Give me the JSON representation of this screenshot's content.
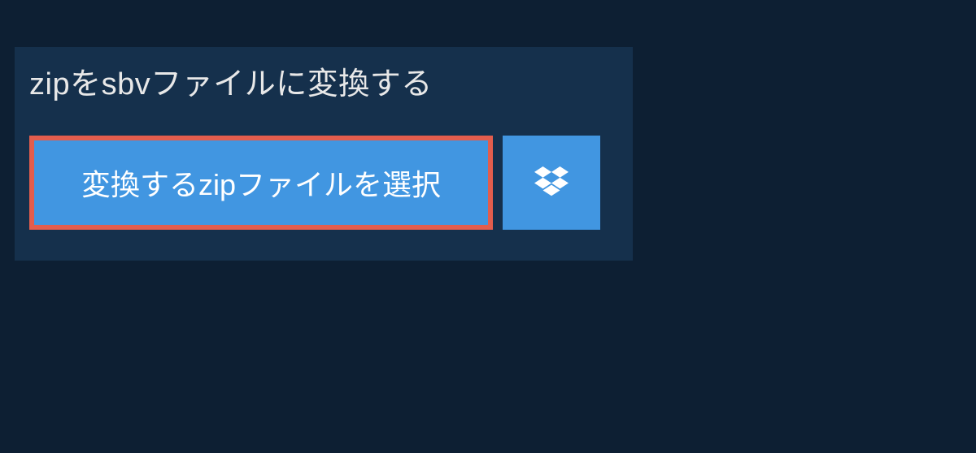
{
  "header": {
    "title": "zipをsbvファイルに変換する"
  },
  "actions": {
    "select_file_label": "変換するzipファイルを選択"
  },
  "colors": {
    "background": "#0d1f33",
    "panel": "#15304c",
    "button": "#4196e1",
    "highlight_border": "#e35d4d",
    "text_light": "#e8e8e8",
    "text_white": "#ffffff"
  }
}
